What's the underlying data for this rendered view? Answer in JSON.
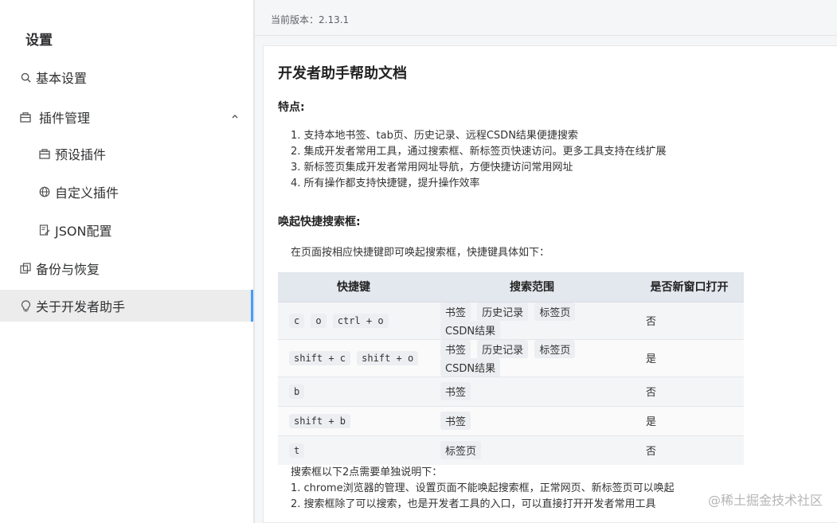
{
  "sidebar": {
    "title": "设置",
    "items": [
      {
        "label": "基本设置",
        "icon": "search-icon"
      },
      {
        "label": "插件管理",
        "icon": "box-icon"
      },
      {
        "label": "预设插件",
        "icon": "box-icon"
      },
      {
        "label": "自定义插件",
        "icon": "globe-icon"
      },
      {
        "label": "JSON配置",
        "icon": "file-edit-icon"
      },
      {
        "label": "备份与恢复",
        "icon": "copy-icon"
      },
      {
        "label": "关于开发者助手",
        "icon": "bulb-icon"
      }
    ]
  },
  "main": {
    "version": "当前版本：2.13.1",
    "doc_title": "开发者助手帮助文档",
    "features_heading": "特点:",
    "features": [
      "1. 支持本地书签、tab页、历史记录、远程CSDN结果便捷搜索",
      "2. 集成开发者常用工具，通过搜索框、新标签页快速访问。更多工具支持在线扩展",
      "3. 新标签页集成开发者常用网址导航，方便快捷访问常用网址",
      "4. 所有操作都支持快捷键，提升操作效率"
    ],
    "shortcut_heading": "唤起快捷搜索框:",
    "shortcut_intro": "在页面按相应快捷键即可唤起搜索框，快捷键具体如下：",
    "table": {
      "headers": [
        "快捷键",
        "搜索范围",
        "是否新窗口打开"
      ],
      "rows": [
        {
          "keys": [
            "c",
            "o",
            "ctrl + o"
          ],
          "scope": [
            "书签",
            "历史记录",
            "标签页",
            "CSDN结果"
          ],
          "new_window": "否"
        },
        {
          "keys": [
            "shift + c",
            "shift + o"
          ],
          "scope": [
            "书签",
            "历史记录",
            "标签页",
            "CSDN结果"
          ],
          "new_window": "是"
        },
        {
          "keys": [
            "b"
          ],
          "scope": [
            "书签"
          ],
          "new_window": "否"
        },
        {
          "keys": [
            "shift + b"
          ],
          "scope": [
            "书签"
          ],
          "new_window": "是"
        },
        {
          "keys": [
            "t"
          ],
          "scope": [
            "标签页"
          ],
          "new_window": "否"
        }
      ]
    },
    "notes_intro": "搜索框以下2点需要单独说明下：",
    "notes": [
      "1. chrome浏览器的管理、设置页面不能唤起搜索框，正常网页、新标签页可以唤起",
      "2. 搜索框除了可以搜索，也是开发者工具的入口，可以直接打开开发者常用工具"
    ],
    "watermark": "@稀土掘金技术社区"
  },
  "colors": {
    "accent": "#409eff",
    "active_bg": "#ececec",
    "table_header_bg": "#e3e7ee"
  }
}
